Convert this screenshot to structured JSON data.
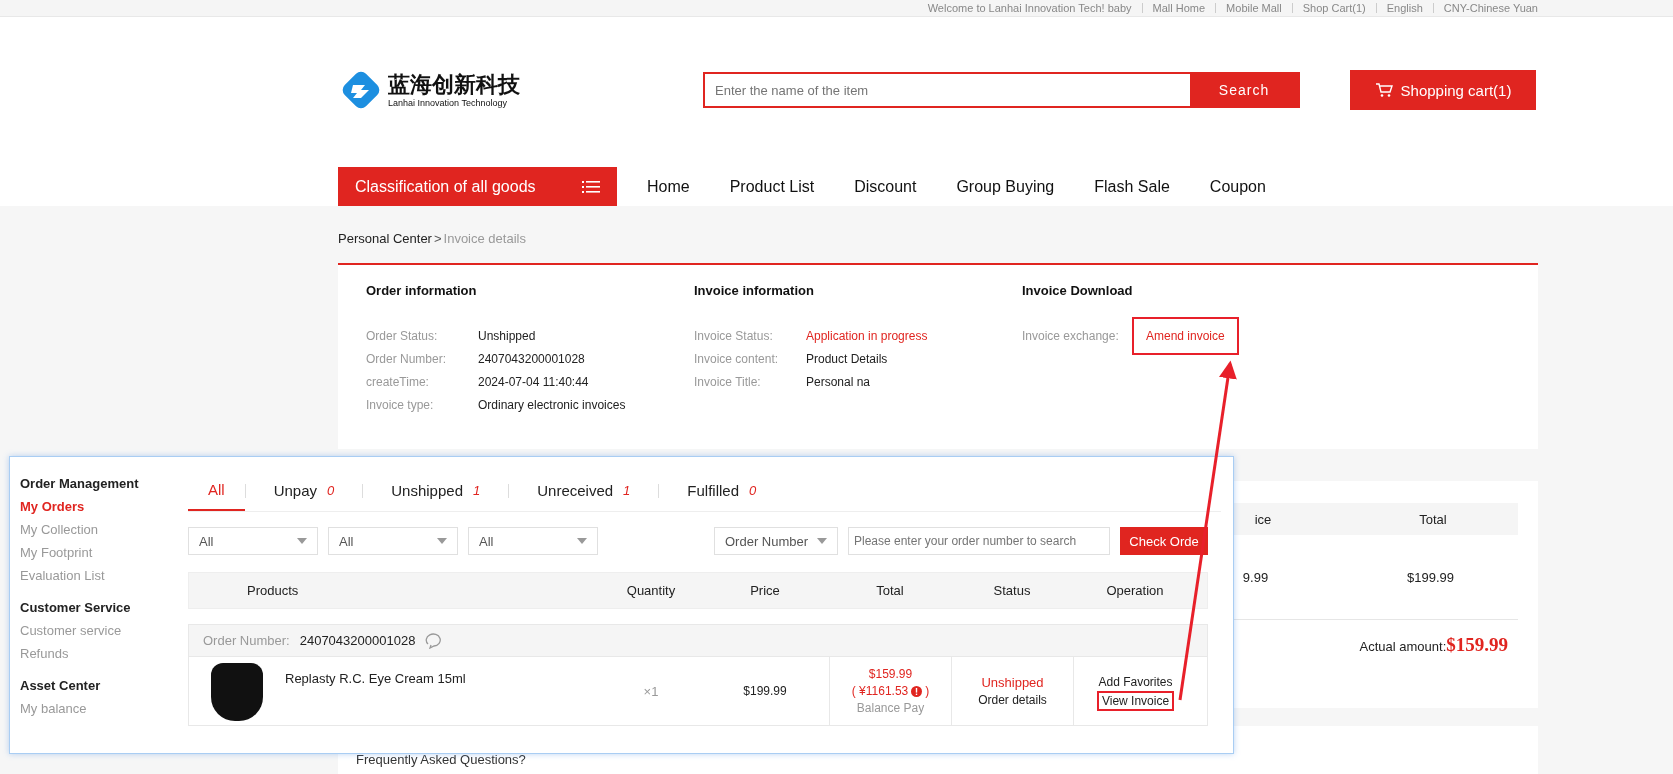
{
  "top_bar": {
    "items": [
      "Welcome to Lanhai Innovation Tech!  baby",
      "Mall Home",
      "Mobile Mall",
      "Shop Cart(1)",
      "English",
      "CNY-Chinese Yuan"
    ]
  },
  "header": {
    "logo_cn": "蓝海创新科技",
    "logo_en": "Lanhai Innovation Technology",
    "search": {
      "placeholder": "Enter the name of the item",
      "button": "Search"
    },
    "cart": "Shopping cart(1)"
  },
  "nav": {
    "category": "Classification of all goods",
    "links": [
      "Home",
      "Product List",
      "Discount",
      "Group Buying",
      "Flash Sale",
      "Coupon"
    ]
  },
  "breadcrumb": {
    "parent": "Personal Center",
    "separator": ">",
    "current": "Invoice details"
  },
  "invoice_card": {
    "sections": [
      {
        "title": "Order information",
        "fields": [
          {
            "label": "Order Status:",
            "value": "Unshipped",
            "kind": "text"
          },
          {
            "label": "Order Number:",
            "value": "2407043200001028",
            "kind": "text"
          },
          {
            "label": "createTime:",
            "value": "2024-07-04 11:40:44",
            "kind": "text"
          },
          {
            "label": "Invoice type:",
            "value": "Ordinary electronic invoices",
            "kind": "text"
          }
        ]
      },
      {
        "title": "Invoice information",
        "fields": [
          {
            "label": "Invoice Status:",
            "value": "Application in progress",
            "kind": "alert"
          },
          {
            "label": "Invoice content:",
            "value": "Product Details",
            "kind": "text"
          },
          {
            "label": "Invoice Title:",
            "value": "Personal na",
            "kind": "text"
          }
        ]
      },
      {
        "title": "Invoice Download",
        "fields": [
          {
            "label": "Invoice exchange:",
            "value": "Amend invoice",
            "kind": "link",
            "highlighted": true
          }
        ]
      }
    ]
  },
  "summary_card": {
    "columns": [
      "ice",
      "Total"
    ],
    "values": [
      "9.99",
      "$199.99"
    ],
    "actual_label": "Actual amount:",
    "actual_value": "$159.99"
  },
  "faq": {
    "title": "Frequently Asked Questions?"
  },
  "orders_panel": {
    "sidebar": [
      {
        "title": "Order Management",
        "items": [
          {
            "label": "My Orders",
            "selected": true
          },
          {
            "label": "My Collection",
            "selected": false
          },
          {
            "label": "My Footprint",
            "selected": false
          },
          {
            "label": "Evaluation List",
            "selected": false
          }
        ]
      },
      {
        "title": "Customer Service",
        "items": [
          {
            "label": "Customer service",
            "selected": false
          },
          {
            "label": "Refunds",
            "selected": false
          }
        ]
      },
      {
        "title": "Asset Center",
        "items": [
          {
            "label": "My balance",
            "selected": false
          }
        ]
      }
    ],
    "tabs": [
      {
        "label": "All",
        "selected": true
      },
      {
        "label": "Unpay",
        "count": "0",
        "selected": false
      },
      {
        "label": "Unshipped",
        "count": "1",
        "selected": false
      },
      {
        "label": "Unreceived",
        "count": "1",
        "selected": false
      },
      {
        "label": "Fulfilled",
        "count": "0",
        "selected": false
      }
    ],
    "filters": [
      "All",
      "All",
      "All"
    ],
    "search_type": "Order Number",
    "search_placeholder": "Please enter your order number to search",
    "search_button": "Check Orde",
    "columns": [
      "Products",
      "Quantity",
      "Price",
      "Total",
      "Status",
      "Operation"
    ],
    "order": {
      "number_label": "Order Number:",
      "number": "2407043200001028",
      "product": "Replasty R.C. Eye Cream 15ml",
      "quantity": "×1",
      "price": "$199.99",
      "total": "$159.99",
      "converted": "( ¥1161.53",
      "converted_close": ")",
      "payment": "Balance Pay",
      "status": "Unshipped",
      "details": "Order details",
      "operations": [
        {
          "label": "Add Favorites",
          "highlighted": false
        },
        {
          "label": "View Invoice",
          "highlighted": true
        }
      ]
    }
  }
}
